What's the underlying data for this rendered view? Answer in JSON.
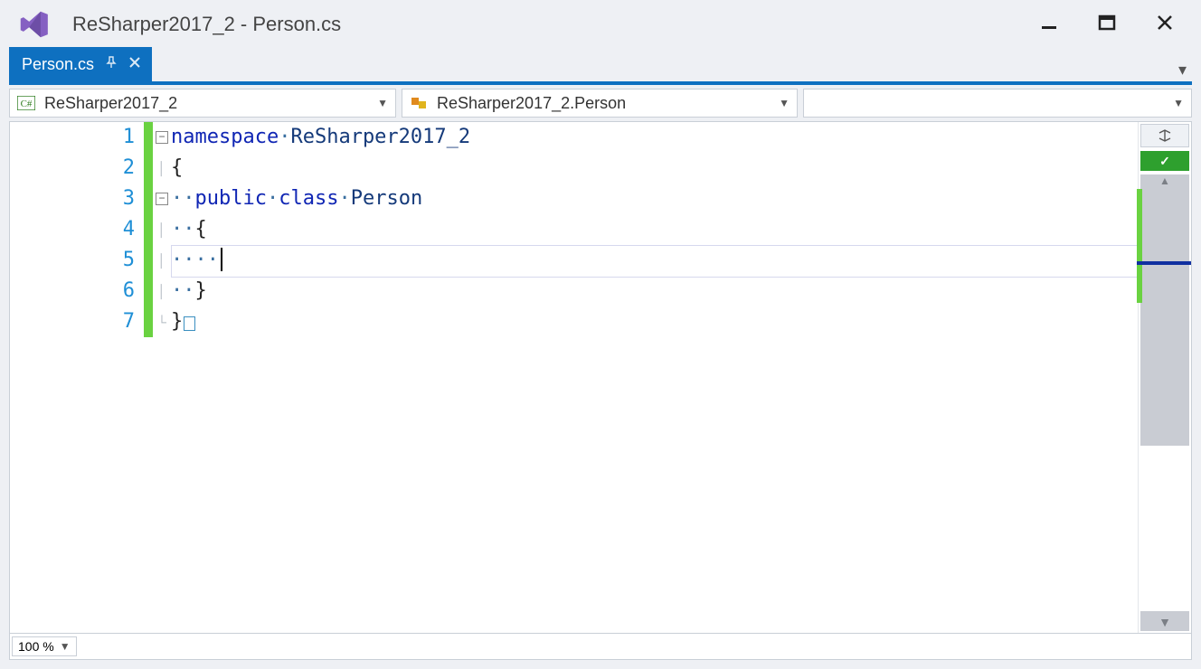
{
  "window": {
    "title": "ReSharper2017_2 - Person.cs"
  },
  "tab": {
    "label": "Person.cs"
  },
  "nav": {
    "scope1": "ReSharper2017_2",
    "scope2": "ReSharper2017_2.Person",
    "scope3": ""
  },
  "zoom": {
    "value": "100 %"
  },
  "code": {
    "line_numbers": [
      "1",
      "2",
      "3",
      "4",
      "5",
      "6",
      "7"
    ],
    "keywords": {
      "namespace": "namespace",
      "public": "public",
      "class": "class"
    },
    "identifiers": {
      "ns": "ReSharper2017_2",
      "type": "Person"
    },
    "braces": {
      "open": "{",
      "close": "}"
    },
    "whitespace_dot": "·"
  },
  "status": {
    "ok_mark": "✓"
  }
}
